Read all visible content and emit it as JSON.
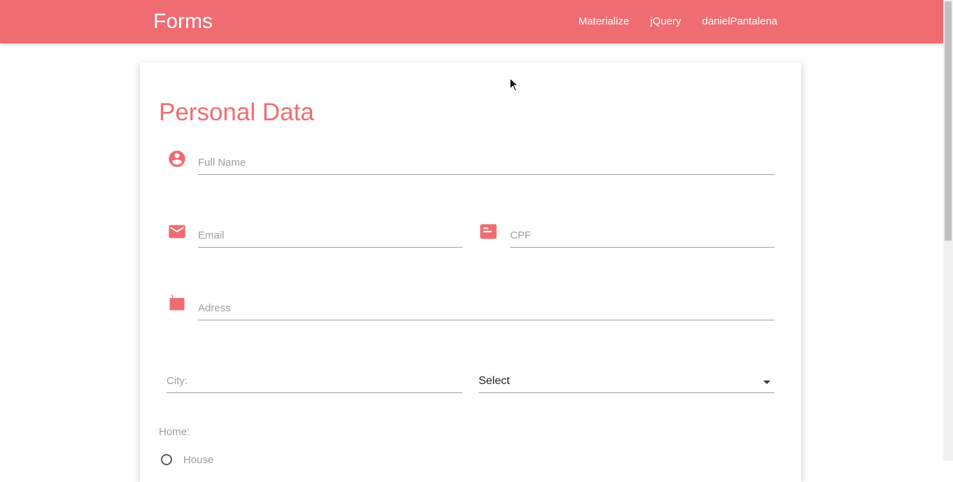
{
  "navbar": {
    "brand": "Forms",
    "links": [
      "Materialize",
      "jQuery",
      "danielPantalena"
    ],
    "color": "#ef6c72"
  },
  "card": {
    "title": "Personal Data",
    "fields": {
      "full_name": {
        "label": "Full Name",
        "icon": "account-circle-icon"
      },
      "email": {
        "label": "Email",
        "icon": "email-icon"
      },
      "cpf": {
        "label": "CPF",
        "icon": "card-icon"
      },
      "address": {
        "label": "Adress",
        "icon": "mailbox-icon"
      },
      "city": {
        "label": "City:"
      },
      "state_select": {
        "value": "Select"
      }
    },
    "home": {
      "label": "Home:",
      "options": [
        "House"
      ]
    }
  },
  "colors": {
    "accent": "#ef6c72",
    "line": "#9e9e9e"
  }
}
